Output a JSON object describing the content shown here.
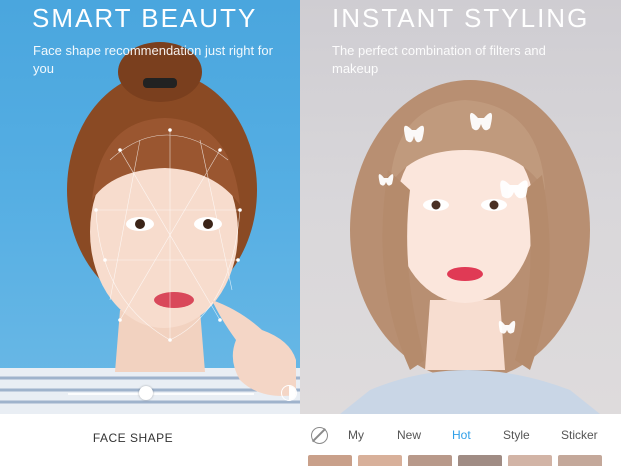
{
  "left_panel": {
    "headline": "SMART BEAUTY",
    "subtitle": "Face shape recommendation just right for you",
    "slider_level": 0.42,
    "bottom_label": "FACE SHAPE"
  },
  "right_panel": {
    "headline": "INSTANT STYLING",
    "subtitle": "The perfect combination of filters and makeup",
    "tabs": [
      {
        "label": "My"
      },
      {
        "label": "New"
      },
      {
        "label": "Hot"
      },
      {
        "label": "Style"
      },
      {
        "label": "Sticker"
      }
    ],
    "active_tab": "Hot",
    "icons": {
      "no_filter": "no-filter-icon",
      "compare": "compare-icon"
    }
  },
  "colors": {
    "left_background": "#55aee3",
    "right_background": "#d9d7da",
    "active_tab": "#2f9fe8",
    "text": "#555555"
  }
}
